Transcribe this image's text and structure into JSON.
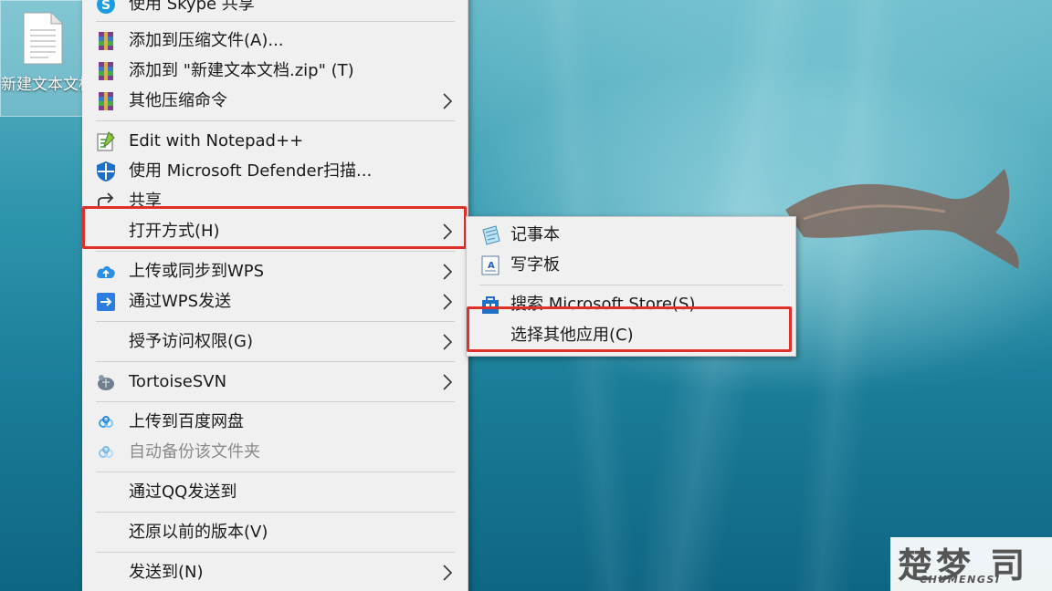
{
  "desktop": {
    "file_name": "新建文本文档.txt"
  },
  "context_menu": {
    "items": [
      {
        "label": "使用 Skype 共享",
        "icon": "skype-icon"
      },
      {
        "label": "添加到压缩文件(A)...",
        "icon": "winrar-icon"
      },
      {
        "label": "添加到 \"新建文本文档.zip\" (T)",
        "icon": "winrar-icon"
      },
      {
        "label": "其他压缩命令",
        "icon": "winrar-icon",
        "submenu": true
      },
      {
        "label": "Edit with Notepad++",
        "icon": "notepadpp-icon"
      },
      {
        "label": "使用 Microsoft Defender扫描...",
        "icon": "defender-shield-icon"
      },
      {
        "label": "共享",
        "icon": "share-icon"
      },
      {
        "label": "打开方式(H)",
        "submenu": true,
        "highlighted": true
      },
      {
        "label": "上传或同步到WPS",
        "icon": "wps-cloud-upload-icon",
        "submenu": true
      },
      {
        "label": "通过WPS发送",
        "icon": "wps-send-icon",
        "submenu": true
      },
      {
        "label": "授予访问权限(G)",
        "submenu": true
      },
      {
        "label": "TortoiseSVN",
        "icon": "tortoisesvn-icon",
        "submenu": true
      },
      {
        "label": "上传到百度网盘",
        "icon": "baidu-netdisk-icon"
      },
      {
        "label": "自动备份该文件夹",
        "icon": "baidu-netdisk-icon",
        "disabled": true
      },
      {
        "label": "通过QQ发送到"
      },
      {
        "label": "还原以前的版本(V)"
      },
      {
        "label": "发送到(N)",
        "submenu": true
      }
    ]
  },
  "open_with_submenu": {
    "items": [
      {
        "label": "记事本",
        "icon": "notepad-icon"
      },
      {
        "label": "写字板",
        "icon": "wordpad-icon"
      },
      {
        "label": "搜索 Microsoft Store(S)",
        "icon": "microsoft-store-icon"
      },
      {
        "label": "选择其他应用(C)",
        "highlighted": true
      }
    ]
  },
  "watermark": {
    "chinese": "楚梦 司",
    "latin": "CHUMENGSI"
  },
  "colors": {
    "menu_bg": "#f0f0f0",
    "highlight_border": "#e0302a",
    "separator": "#cfcfcf",
    "disabled_text": "#8a8a8a"
  }
}
